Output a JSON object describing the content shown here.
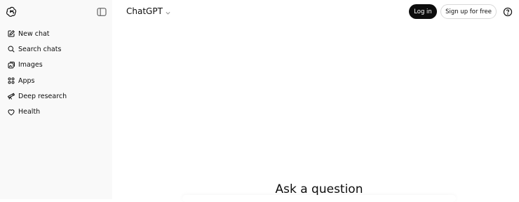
{
  "sidebar": {
    "items": [
      {
        "label": "New chat",
        "icon": "new-chat-icon"
      },
      {
        "label": "Search chats",
        "icon": "search-icon"
      },
      {
        "label": "Images",
        "icon": "images-icon"
      },
      {
        "label": "Apps",
        "icon": "apps-icon"
      },
      {
        "label": "Deep research",
        "icon": "telescope-icon"
      },
      {
        "label": "Health",
        "icon": "heart-icon"
      }
    ]
  },
  "header": {
    "model_label": "ChatGPT",
    "login_label": "Log in",
    "signup_label": "Sign up for free"
  },
  "main": {
    "prompt_heading": "Ask a question"
  },
  "colors": {
    "sidebar_bg": "#f9f9f9",
    "primary_button": "#0d0d0d",
    "text": "#0d0d0d"
  }
}
